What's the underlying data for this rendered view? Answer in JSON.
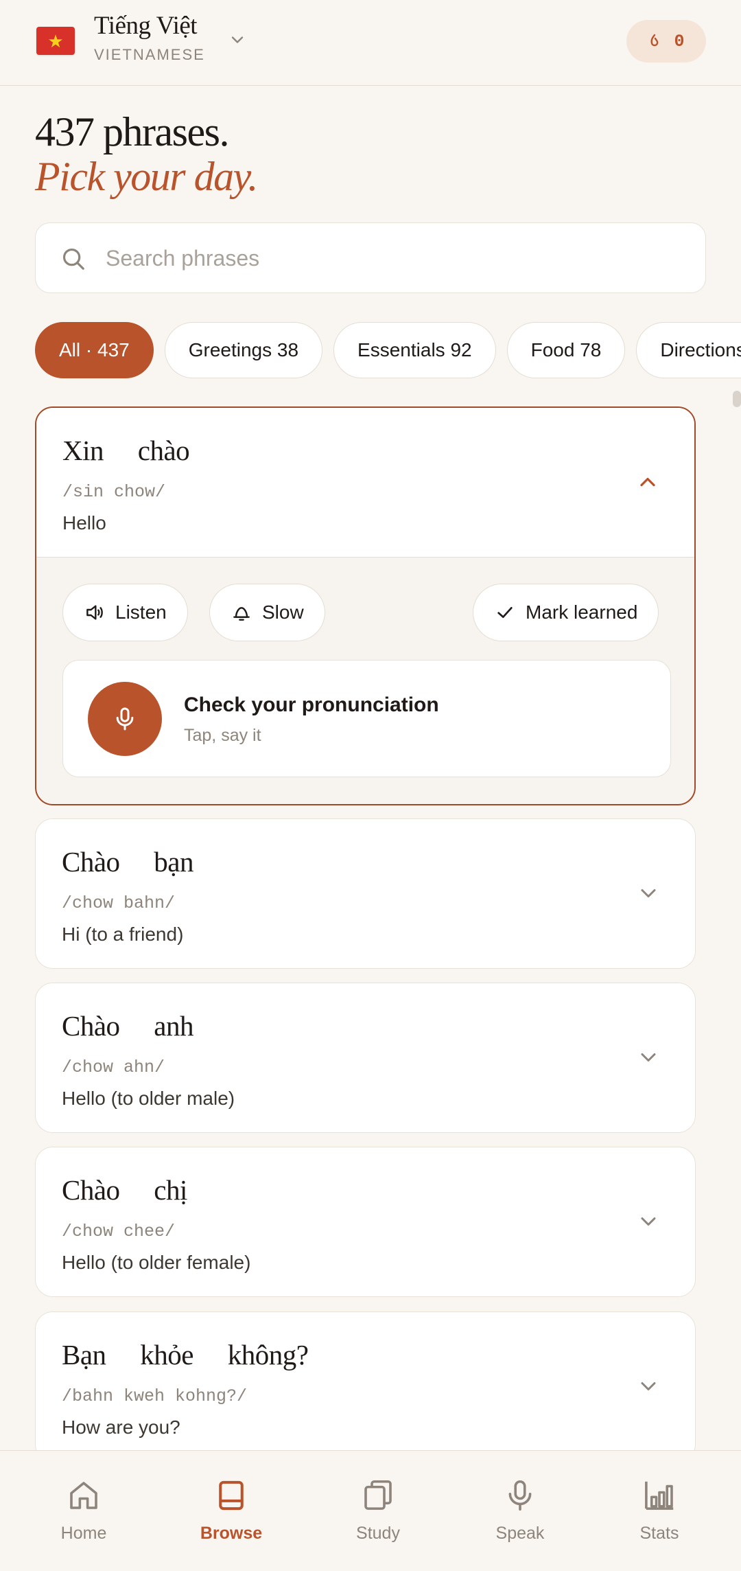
{
  "header": {
    "flag_glyph": "★",
    "language_name": "Tiếng Việt",
    "language_sub": "VIETNAMESE",
    "streak_count": "0"
  },
  "headline": {
    "line1": "437 phrases.",
    "line2": "Pick your day."
  },
  "search": {
    "placeholder": "Search phrases",
    "value": ""
  },
  "chips": [
    {
      "label": "All · 437",
      "active": true
    },
    {
      "label": "Greetings 38"
    },
    {
      "label": "Essentials 92"
    },
    {
      "label": "Food 78"
    },
    {
      "label": "Directions"
    }
  ],
  "phrases": [
    {
      "phrase": "Xin chào",
      "pron": "/sin chow/",
      "meaning": "Hello",
      "expanded": true
    },
    {
      "phrase": "Chào bạn",
      "pron": "/chow bahn/",
      "meaning": "Hi (to a friend)"
    },
    {
      "phrase": "Chào anh",
      "pron": "/chow ahn/",
      "meaning": "Hello (to older male)"
    },
    {
      "phrase": "Chào chị",
      "pron": "/chow chee/",
      "meaning": "Hello (to older female)"
    },
    {
      "phrase": "Bạn khỏe không?",
      "pron": "/bahn kweh kohng?/",
      "meaning": "How are you?"
    }
  ],
  "actions": {
    "listen": "Listen",
    "slow": "Slow",
    "mark_learned": "Mark learned",
    "check_title": "Check your pronunciation",
    "check_sub": "Tap, say it"
  },
  "nav": [
    {
      "label": "Home",
      "icon": "home-icon"
    },
    {
      "label": "Browse",
      "icon": "book-icon",
      "active": true
    },
    {
      "label": "Study",
      "icon": "cards-icon"
    },
    {
      "label": "Speak",
      "icon": "microphone-icon"
    },
    {
      "label": "Stats",
      "icon": "bar-chart-icon"
    }
  ],
  "colors": {
    "accent": "#b9532b",
    "background": "#f9f6f1",
    "muted": "#8d847b"
  }
}
